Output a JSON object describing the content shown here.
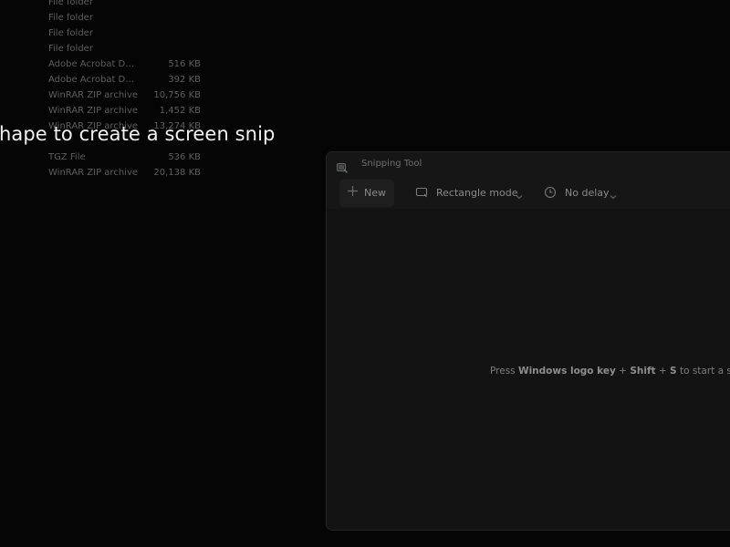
{
  "explorer": {
    "rows": [
      {
        "type": "File folder",
        "size": ""
      },
      {
        "type": "File folder",
        "size": ""
      },
      {
        "type": "File folder",
        "size": ""
      },
      {
        "type": "File folder",
        "size": ""
      },
      {
        "type": "Adobe Acrobat Docu...",
        "size": "516 KB"
      },
      {
        "type": "Adobe Acrobat Docu...",
        "size": "392 KB"
      },
      {
        "type": "WinRAR ZIP archive",
        "size": "10,756 KB"
      },
      {
        "type": "WinRAR ZIP archive",
        "size": "1,452 KB"
      },
      {
        "type": "WinRAR ZIP archive",
        "size": "13,274 KB"
      },
      {
        "type": "",
        "size": ""
      },
      {
        "type": "TGZ File",
        "size": "536 KB"
      },
      {
        "type": "WinRAR ZIP archive",
        "size": "20,138 KB"
      }
    ]
  },
  "overlay": {
    "hint": "hape to create a screen snip"
  },
  "snipping_tool": {
    "title": "Snipping Tool",
    "toolbar": {
      "new_label": "New",
      "mode_label": "Rectangle mode",
      "delay_label": "No delay"
    },
    "empty_hint": {
      "prefix": "Press ",
      "key1": "Windows logo key",
      "sep1": " + ",
      "key2": "Shift",
      "sep2": " + ",
      "key3": "S",
      "suffix": " to start a snip."
    }
  },
  "colors": {
    "background": "#050505",
    "window": "#161616",
    "overlay_text": "#f2f2f2"
  }
}
